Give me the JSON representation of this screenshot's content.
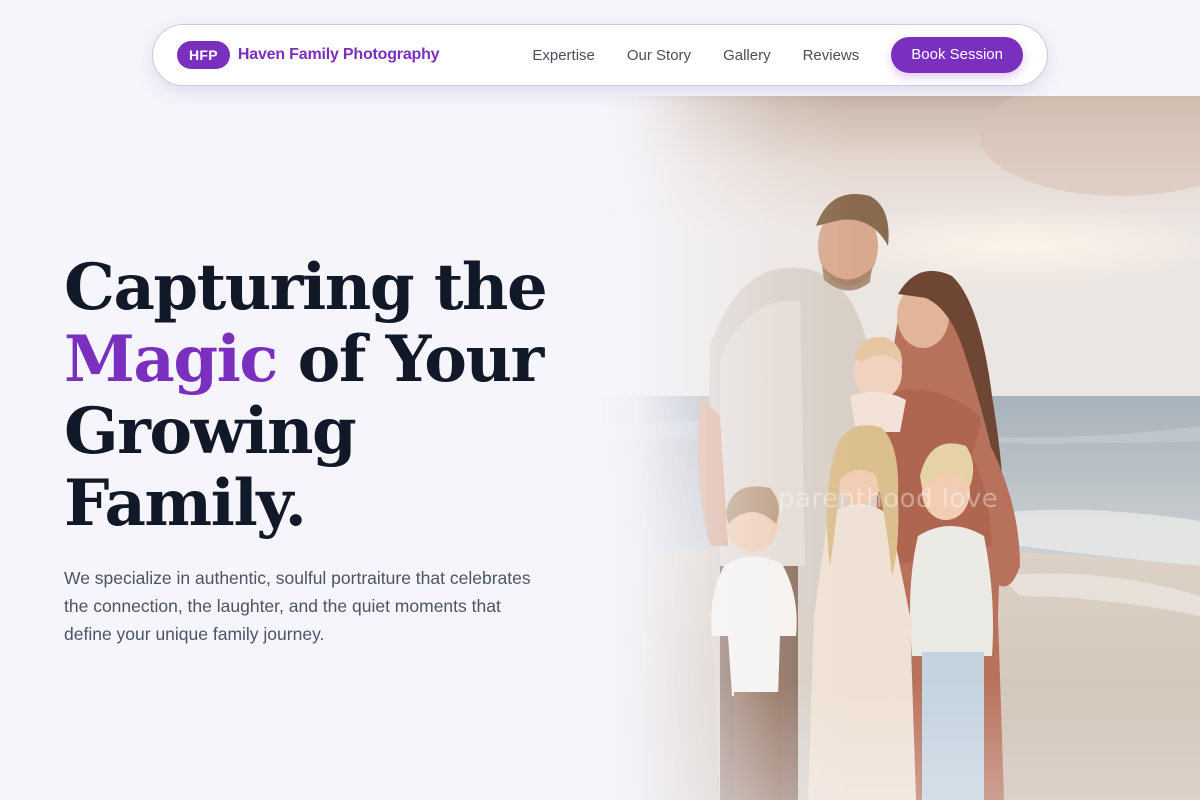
{
  "nav": {
    "badge": "HFP",
    "brand_name": "Haven Family Photography",
    "links": [
      "Expertise",
      "Our Story",
      "Gallery",
      "Reviews"
    ],
    "cta_label": "Book Session"
  },
  "hero": {
    "title_line1": "Capturing the",
    "title_accent": "Magic",
    "title_line2_rest": " of Your",
    "title_line3": "Growing",
    "title_line4": "Family.",
    "subtitle": "We specialize in authentic, soulful portraiture that celebrates the connection, the laughter, and the quiet moments that define your unique family journey.",
    "photo_watermark": "parenthood love"
  },
  "colors": {
    "brand": "#7b2fbf",
    "heading": "#111827",
    "body_text": "#4b5563",
    "background": "#f6f5fb"
  }
}
